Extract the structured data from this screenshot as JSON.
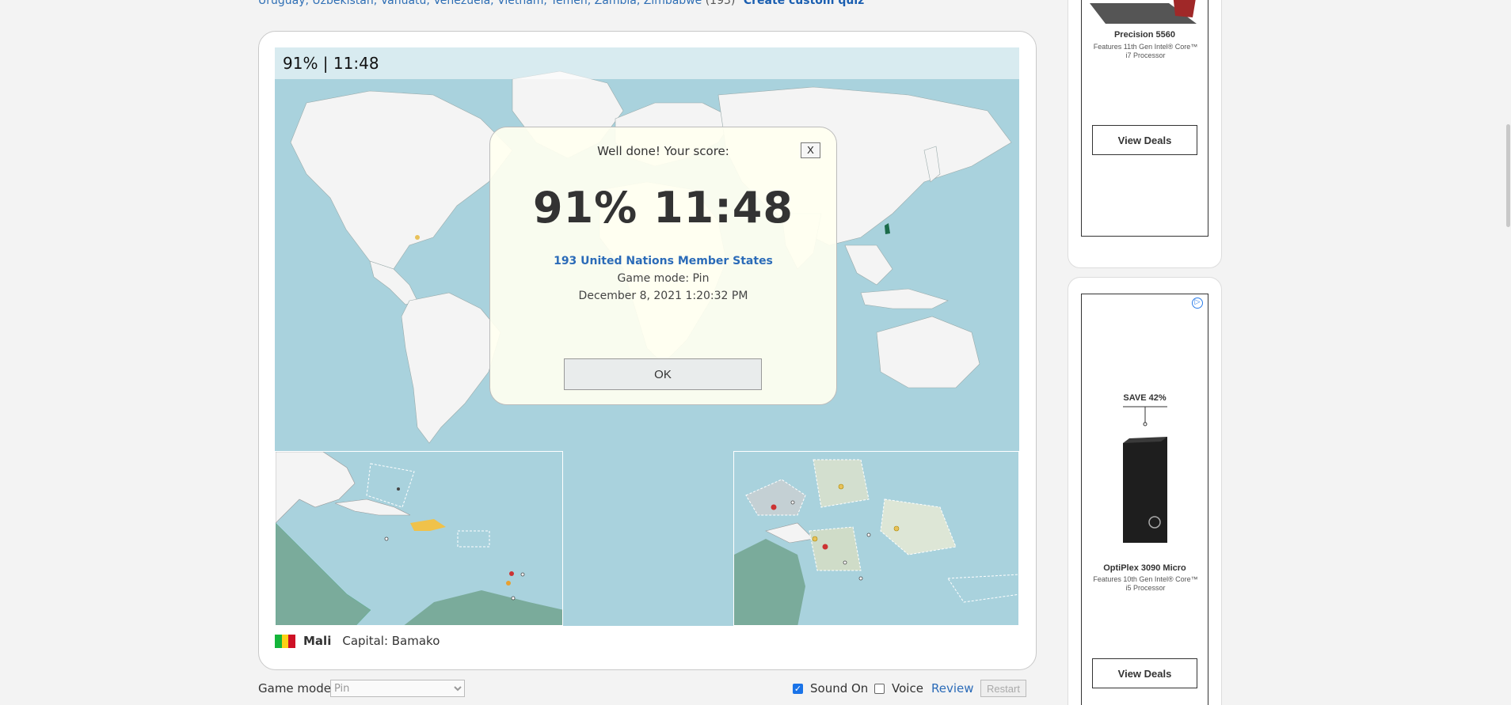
{
  "top_list": {
    "countries_text": "Uruguay, Uzbekistan, Vanuatu, Venezuela, Vietnam, Yemen, Zambia, Zimbabwe",
    "count": "(193)",
    "custom_link": "Create custom quiz"
  },
  "game": {
    "score_bar": "91% | 11:48",
    "modal": {
      "heading": "Well done! Your score:",
      "close_label": "X",
      "score": "91% 11:48",
      "quiz_link": "193 United Nations Member States",
      "game_mode": "Game mode: Pin",
      "date": "December 8, 2021  1:20:32 PM",
      "ok_label": "OK"
    },
    "target": {
      "name": "Mali",
      "capital": "Capital: Bamako",
      "flag_colors": [
        "#14b53a",
        "#fcd116",
        "#ce1126"
      ]
    }
  },
  "controls": {
    "game_mode_label": "Game mode:",
    "game_mode_value": "Pin",
    "sound_label": "Sound On",
    "sound_checked": true,
    "voice_label": "Voice",
    "voice_checked": false,
    "review_label": "Review",
    "restart_label": "Restart"
  },
  "ads": [
    {
      "product": "Precision 5560",
      "description": "Features 11th Gen Intel® Core™ i7 Processor",
      "button": "View Deals"
    },
    {
      "tag": "SAVE 42%",
      "product": "OptiPlex 3090 Micro",
      "description": "Features 10th Gen Intel® Core™ i5 Processor",
      "button": "View Deals",
      "badge": "▷"
    }
  ],
  "colors": {
    "ocean": "#a9d2dd",
    "land": "#f4f4f4",
    "link": "#2b6bb8"
  }
}
